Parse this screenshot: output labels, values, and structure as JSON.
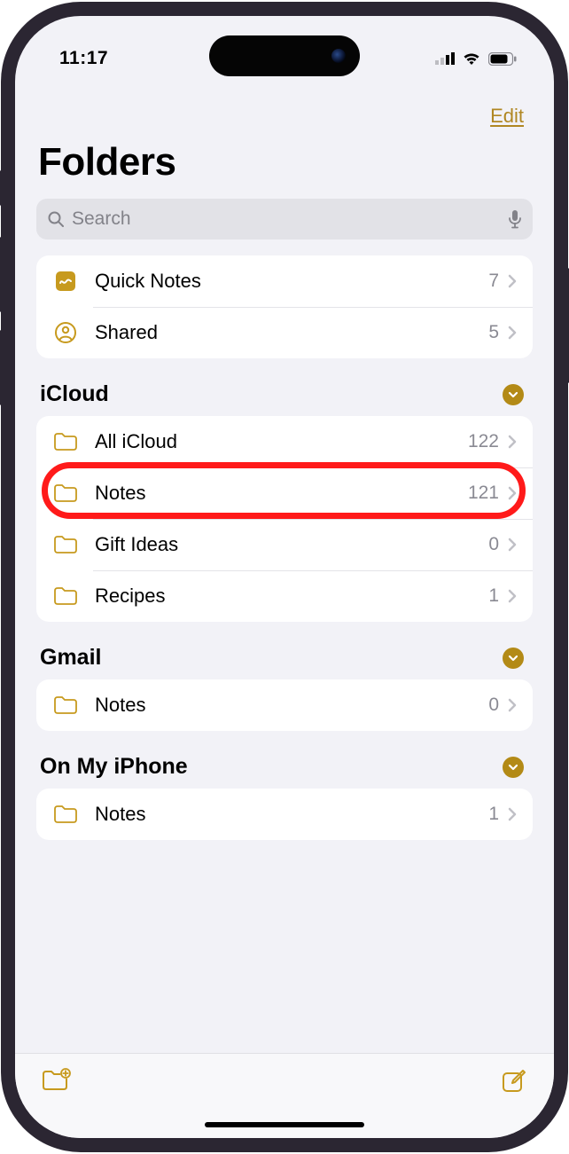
{
  "status": {
    "time": "11:17"
  },
  "header": {
    "edit_label": "Edit",
    "title": "Folders"
  },
  "search": {
    "placeholder": "Search"
  },
  "smart_group": [
    {
      "icon": "quicknotes-icon",
      "label": "Quick Notes",
      "count": "7"
    },
    {
      "icon": "shared-icon",
      "label": "Shared",
      "count": "5"
    }
  ],
  "sections": [
    {
      "title": "iCloud",
      "folders": [
        {
          "label": "All iCloud",
          "count": "122"
        },
        {
          "label": "Notes",
          "count": "121",
          "highlighted": true
        },
        {
          "label": "Gift Ideas",
          "count": "0"
        },
        {
          "label": "Recipes",
          "count": "1"
        }
      ]
    },
    {
      "title": "Gmail",
      "folders": [
        {
          "label": "Notes",
          "count": "0"
        }
      ]
    },
    {
      "title": "On My iPhone",
      "folders": [
        {
          "label": "Notes",
          "count": "1"
        }
      ]
    }
  ],
  "colors": {
    "accent": "#b38a16",
    "folder_icon": "#c79a1e"
  }
}
